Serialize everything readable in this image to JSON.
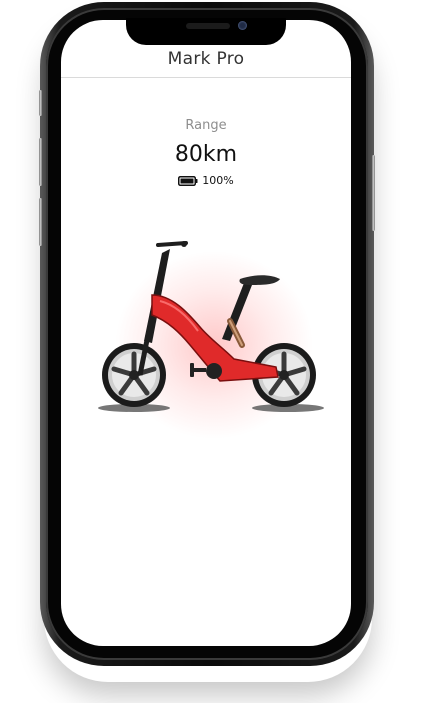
{
  "header": {
    "title": "Mark Pro"
  },
  "range": {
    "label": "Range",
    "value": "80km"
  },
  "battery": {
    "percent_label": "100%",
    "level": 1.0,
    "icon": "battery-full-icon"
  },
  "bike": {
    "image": "folding-electric-bike",
    "frame_color": "#e02a2a",
    "glow_color": "#ff3c3c"
  },
  "device": {
    "frame": "phone-bezel"
  }
}
